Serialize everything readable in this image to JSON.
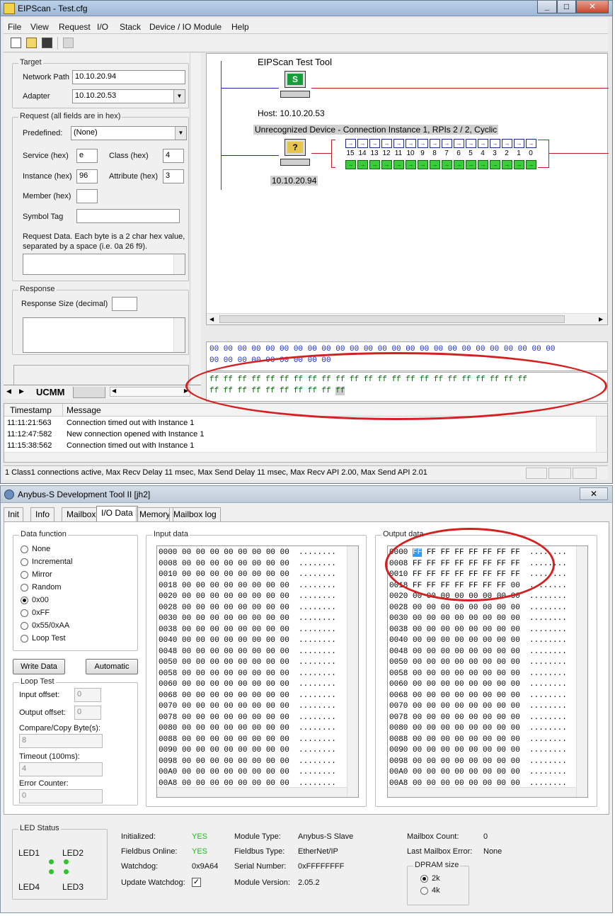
{
  "eip": {
    "title": "EIPScan - Test.cfg",
    "menu": [
      "File",
      "View",
      "Request",
      "I/O",
      "Stack",
      "Device / IO Module",
      "Help"
    ],
    "target": {
      "group": "Target",
      "network_path_label": "Network Path",
      "network_path": "10.10.20.94",
      "adapter_label": "Adapter",
      "adapter": "10.10.20.53"
    },
    "request": {
      "group": "Request (all fields are in hex)",
      "predefined_label": "Predefined:",
      "predefined": "(None)",
      "service_label": "Service (hex)",
      "service": "e",
      "class_label": "Class (hex)",
      "class": "4",
      "instance_label": "Instance (hex)",
      "instance": "96",
      "attribute_label": "Attribute (hex)",
      "attribute": "3",
      "member_label": "Member (hex)",
      "symbol_label": "Symbol Tag",
      "data_note_1": "Request Data. Each byte is a 2 char hex value,",
      "data_note_2": "separated by a space (i.e. 0a 26 f9)."
    },
    "response": {
      "group": "Response",
      "size_label": "Response Size (decimal)"
    },
    "tab": "UCMM",
    "diagram": {
      "host_title": "EIPScan Test Tool",
      "host_label": "Host: 10.10.20.53",
      "device_title": "Unrecognized Device - Connection Instance 1, RPIs 2 / 2, Cyclic",
      "device_ip": "10.10.20.94",
      "host_icon_letter": "S",
      "device_icon_letter": "?",
      "bits": [
        "15",
        "14",
        "13",
        "12",
        "11",
        "10",
        "9",
        "8",
        "7",
        "6",
        "5",
        "4",
        "3",
        "2",
        "1",
        "0"
      ]
    },
    "input_hex_1": "00 00 00 00 00 00 00 00 00 00 00 00 00 00 00 00 00 00 00 00 00 00 00 00 00",
    "input_hex_2": "00 00 00 00 00 00 00 00 00",
    "output_hex_1": "ff ff ff ff ff ff ff ff ff ff ff ff ff ff ff ff ff ff ff ff ff ff ff",
    "output_hex_2": "ff ff ff ff ff ff ff ff ff",
    "output_hex_cursor": "ff",
    "log": {
      "col_timestamp": "Timestamp",
      "col_message": "Message",
      "rows": [
        {
          "ts": "11:11:21:563",
          "msg": "Connection timed out with Instance 1"
        },
        {
          "ts": "11:12:47:582",
          "msg": "New connection opened with Instance 1"
        },
        {
          "ts": "11:15:38:562",
          "msg": "Connection timed out with Instance 1"
        }
      ]
    },
    "status": "1 Class1 connections active, Max Recv Delay 11 msec, Max Send Delay 11 msec, Max Recv API 2.00, Max Send API 2.01"
  },
  "anybus": {
    "title": "Anybus-S Development Tool II [jh2]",
    "tabs": [
      "Init",
      "Info",
      "Mailbox",
      "I/O Data",
      "Memory",
      "Mailbox log"
    ],
    "active_tab": "I/O Data",
    "data_function": {
      "group": "Data function",
      "options": [
        "None",
        "Incremental",
        "Mirror",
        "Random",
        "0x00",
        "0xFF",
        "0x55/0xAA",
        "Loop Test"
      ],
      "selected": "0x00"
    },
    "write_data": "Write Data",
    "automatic": "Automatic",
    "loop": {
      "group": "Loop Test",
      "input_offset_label": "Input offset:",
      "input_offset": "0",
      "output_offset_label": "Output offset:",
      "output_offset": "0",
      "compare_label": "Compare/Copy Byte(s):",
      "compare": "8",
      "timeout_label": "Timeout (100ms):",
      "timeout": "4",
      "error_label": "Error Counter:",
      "error": "0"
    },
    "input_title": "Input data",
    "output_title": "Output data",
    "input_rows": [
      "0000 00 00 00 00 00 00 00 00  ........",
      "0008 00 00 00 00 00 00 00 00  ........",
      "0010 00 00 00 00 00 00 00 00  ........",
      "0018 00 00 00 00 00 00 00 00  ........",
      "0020 00 00 00 00 00 00 00 00  ........",
      "0028 00 00 00 00 00 00 00 00  ........",
      "0030 00 00 00 00 00 00 00 00  ........",
      "0038 00 00 00 00 00 00 00 00  ........",
      "0040 00 00 00 00 00 00 00 00  ........",
      "0048 00 00 00 00 00 00 00 00  ........",
      "0050 00 00 00 00 00 00 00 00  ........",
      "0058 00 00 00 00 00 00 00 00  ........",
      "0060 00 00 00 00 00 00 00 00  ........",
      "0068 00 00 00 00 00 00 00 00  ........",
      "0070 00 00 00 00 00 00 00 00  ........",
      "0078 00 00 00 00 00 00 00 00  ........",
      "0080 00 00 00 00 00 00 00 00  ........",
      "0088 00 00 00 00 00 00 00 00  ........",
      "0090 00 00 00 00 00 00 00 00  ........",
      "0098 00 00 00 00 00 00 00 00  ........",
      "00A0 00 00 00 00 00 00 00 00  ........",
      "00A8 00 00 00 00 00 00 00 00  ........"
    ],
    "output_first_addr": "0000",
    "output_first_sel": "FF",
    "output_first_rest": " FF FF FF FF FF FF FF  ........",
    "output_rows": [
      "0008 FF FF FF FF FF FF FF FF  ........",
      "0010 FF FF FF FF FF FF FF FF  ........",
      "0018 FF FF FF FF FF FF FF 00  ........",
      "0020 00 00 00 00 00 00 00 00  ........",
      "0028 00 00 00 00 00 00 00 00  ........",
      "0030 00 00 00 00 00 00 00 00  ........",
      "0038 00 00 00 00 00 00 00 00  ........",
      "0040 00 00 00 00 00 00 00 00  ........",
      "0048 00 00 00 00 00 00 00 00  ........",
      "0050 00 00 00 00 00 00 00 00  ........",
      "0058 00 00 00 00 00 00 00 00  ........",
      "0060 00 00 00 00 00 00 00 00  ........",
      "0068 00 00 00 00 00 00 00 00  ........",
      "0070 00 00 00 00 00 00 00 00  ........",
      "0078 00 00 00 00 00 00 00 00  ........",
      "0080 00 00 00 00 00 00 00 00  ........",
      "0088 00 00 00 00 00 00 00 00  ........",
      "0090 00 00 00 00 00 00 00 00  ........",
      "0098 00 00 00 00 00 00 00 00  ........",
      "00A0 00 00 00 00 00 00 00 00  ........",
      "00A8 00 00 00 00 00 00 00 00  ........"
    ],
    "led": {
      "group": "LED Status",
      "led1": "LED1",
      "led2": "LED2",
      "led3": "LED3",
      "led4": "LED4"
    },
    "info": {
      "initialized_label": "Initialized:",
      "initialized": "YES",
      "fieldbus_online_label": "Fieldbus Online:",
      "fieldbus_online": "YES",
      "watchdog_label": "Watchdog:",
      "watchdog": "0x9A64",
      "update_watchdog_label": "Update Watchdog:",
      "update_watchdog_check": "✓",
      "module_type_label": "Module Type:",
      "module_type": "Anybus-S Slave",
      "fieldbus_type_label": "Fieldbus Type:",
      "fieldbus_type": "EtherNet/IP",
      "serial_label": "Serial Number:",
      "serial": "0xFFFFFFFF",
      "module_version_label": "Module Version:",
      "module_version": "2.05.2",
      "mailbox_count_label": "Mailbox Count:",
      "mailbox_count": "0",
      "last_mailbox_error_label": "Last Mailbox Error:",
      "last_mailbox_error": "None",
      "dpram_group": "DPRAM size",
      "dpram_2k": "2k",
      "dpram_4k": "4k"
    }
  }
}
